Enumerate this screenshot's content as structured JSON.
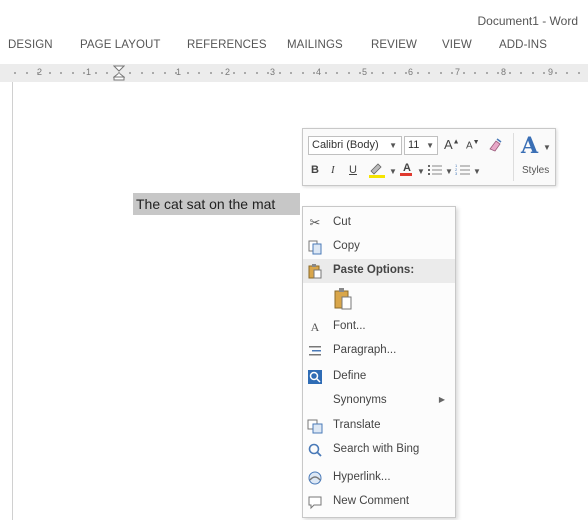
{
  "window": {
    "title": "Document1 - Word"
  },
  "ribbon": {
    "tabs": [
      "DESIGN",
      "PAGE LAYOUT",
      "REFERENCES",
      "MAILINGS",
      "REVIEW",
      "VIEW",
      "ADD-INS"
    ]
  },
  "ruler": {
    "labels": [
      "2",
      "1",
      "1",
      "2",
      "3",
      "4",
      "5",
      "6",
      "7",
      "8",
      "9"
    ]
  },
  "document": {
    "selected_text": "The cat sat on the mat"
  },
  "mini_toolbar": {
    "font_name": "Calibri (Body)",
    "font_size": "11",
    "grow_font": "A",
    "shrink_font": "A",
    "bold": "B",
    "italic": "I",
    "underline": "U",
    "font_color": "A",
    "styles_glyph": "A",
    "styles_label": "Styles",
    "highlight_color": "#f5e400",
    "font_color_bar": "#e03a2f"
  },
  "context_menu": {
    "items": [
      {
        "label": "Cut",
        "icon": "scissors-icon"
      },
      {
        "label": "Copy",
        "icon": "copy-icon"
      },
      {
        "label": "Paste Options:",
        "icon": "paste-icon"
      },
      {
        "label": "Font...",
        "icon": "font-icon"
      },
      {
        "label": "Paragraph...",
        "icon": "paragraph-icon"
      },
      {
        "label": "Define",
        "icon": "define-icon"
      },
      {
        "label": "Synonyms",
        "icon": ""
      },
      {
        "label": "Translate",
        "icon": "translate-icon"
      },
      {
        "label": "Search with Bing",
        "icon": "search-icon"
      },
      {
        "label": "Hyperlink...",
        "icon": "hyperlink-icon"
      },
      {
        "label": "New Comment",
        "icon": "comment-icon"
      }
    ]
  },
  "colors": {
    "accent": "#3a6fb5",
    "selection": "#c7c7c7"
  }
}
